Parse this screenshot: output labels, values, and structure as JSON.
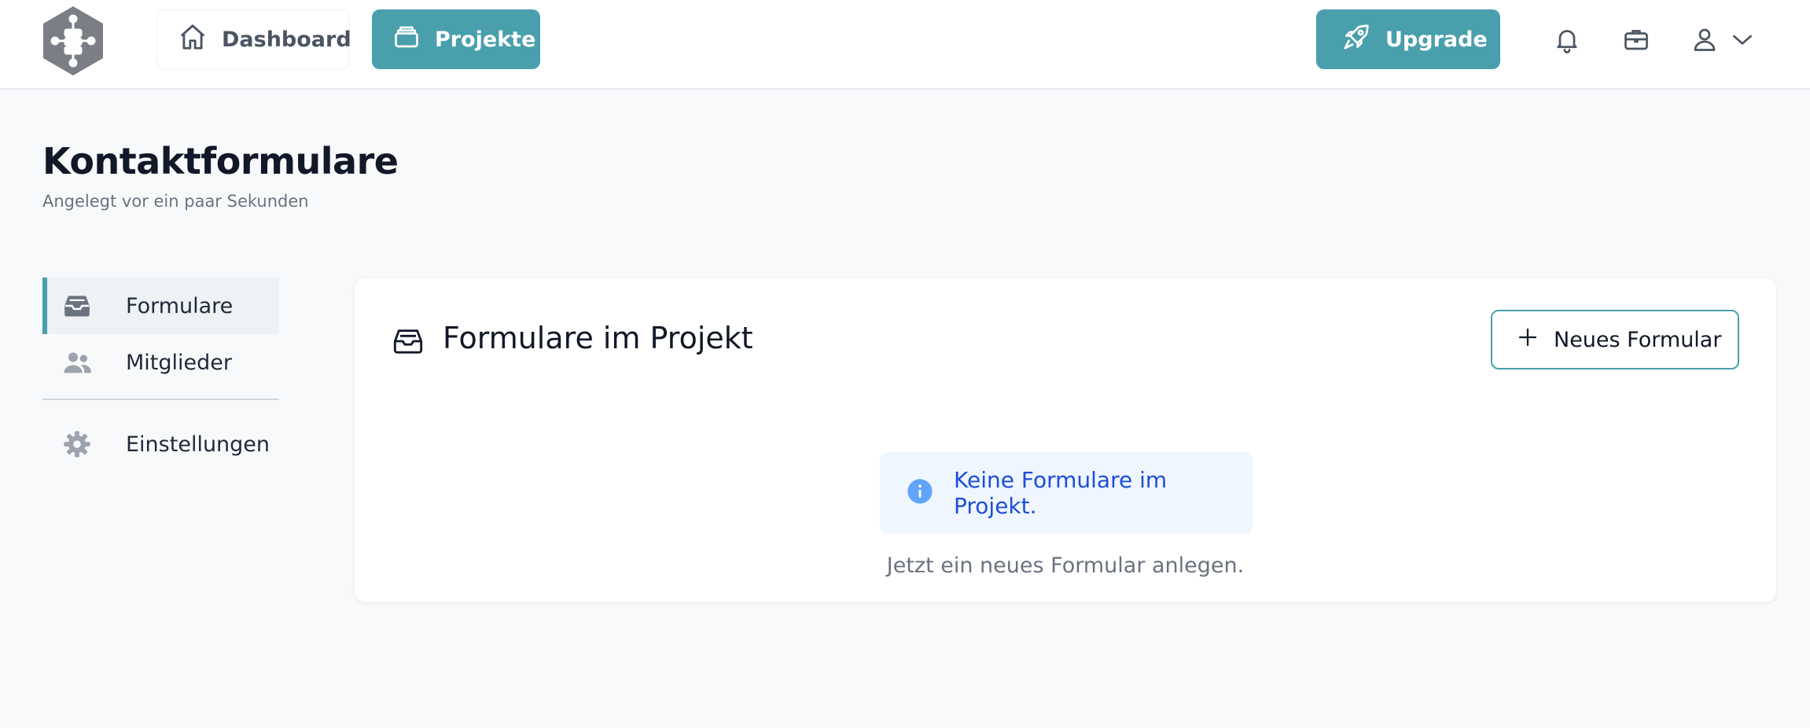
{
  "topbar": {
    "nav": [
      {
        "label": "Dashboard",
        "icon": "home-icon"
      },
      {
        "label": "Projekte",
        "icon": "folder-stack-icon"
      }
    ],
    "upgrade_label": "Upgrade",
    "icons": [
      "bell-icon",
      "briefcase-icon",
      "user-icon",
      "chevron-down-icon"
    ]
  },
  "page": {
    "title": "Kontaktformulare",
    "subtitle": "Angelegt vor ein paar Sekunden"
  },
  "sidebar": {
    "items": [
      {
        "label": "Formulare",
        "icon": "inbox-icon",
        "active": true
      },
      {
        "label": "Mitglieder",
        "icon": "users-icon",
        "active": false
      },
      {
        "label": "Einstellungen",
        "icon": "gear-icon",
        "active": false
      }
    ]
  },
  "card": {
    "title": "Formulare im Projekt",
    "new_button_label": "Neues Formular",
    "empty_message": "Keine Formulare im Projekt.",
    "hint": "Jetzt ein neues Formular anlegen."
  },
  "colors": {
    "accent": "#4a9fad",
    "info_bg": "#eff6ff",
    "info_text": "#1d4ed8",
    "info_icon": "#60a5fa"
  }
}
